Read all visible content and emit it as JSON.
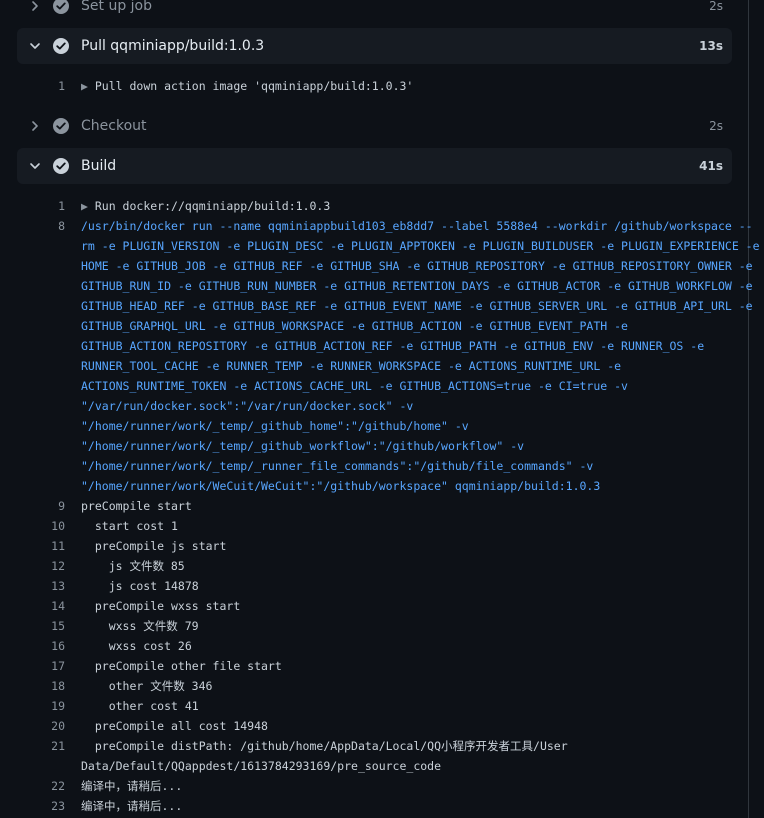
{
  "colors": {
    "background": "#0d1117",
    "panel": "#161b22",
    "success_check": "#8b949e",
    "command_text": "#58a6ff",
    "muted_text": "#8b949e"
  },
  "steps": [
    {
      "name": "Set up job",
      "duration": "2s",
      "state": "collapsed",
      "icon": "check-circle-icon"
    },
    {
      "name": "Pull qqminiapp/build:1.0.3",
      "duration": "13s",
      "state": "expanded",
      "icon": "check-circle-icon"
    },
    {
      "name": "Checkout",
      "duration": "2s",
      "state": "collapsed",
      "icon": "check-circle-icon"
    },
    {
      "name": "Build",
      "duration": "41s",
      "state": "expanded",
      "icon": "check-circle-icon"
    }
  ],
  "pull_log": [
    {
      "num": "1",
      "text": "Pull down action image 'qqminiapp/build:1.0.3'",
      "group": true
    }
  ],
  "build_log": [
    {
      "num": "1",
      "text": "Run docker://qqminiapp/build:1.0.3",
      "group": true
    },
    {
      "num": "8",
      "text": "/usr/bin/docker run --name qqminiappbuild103_eb8dd7 --label 5588e4 --workdir /github/workspace --",
      "cmd": true
    },
    {
      "num": "",
      "text": "rm -e PLUGIN_VERSION -e PLUGIN_DESC -e PLUGIN_APPTOKEN -e PLUGIN_BUILDUSER -e PLUGIN_EXPERIENCE -e",
      "cmd": true
    },
    {
      "num": "",
      "text": "HOME -e GITHUB_JOB -e GITHUB_REF -e GITHUB_SHA -e GITHUB_REPOSITORY -e GITHUB_REPOSITORY_OWNER -e",
      "cmd": true
    },
    {
      "num": "",
      "text": "GITHUB_RUN_ID -e GITHUB_RUN_NUMBER -e GITHUB_RETENTION_DAYS -e GITHUB_ACTOR -e GITHUB_WORKFLOW -e",
      "cmd": true
    },
    {
      "num": "",
      "text": "GITHUB_HEAD_REF -e GITHUB_BASE_REF -e GITHUB_EVENT_NAME -e GITHUB_SERVER_URL -e GITHUB_API_URL -e",
      "cmd": true
    },
    {
      "num": "",
      "text": "GITHUB_GRAPHQL_URL -e GITHUB_WORKSPACE -e GITHUB_ACTION -e GITHUB_EVENT_PATH -e",
      "cmd": true
    },
    {
      "num": "",
      "text": "GITHUB_ACTION_REPOSITORY -e GITHUB_ACTION_REF -e GITHUB_PATH -e GITHUB_ENV -e RUNNER_OS -e",
      "cmd": true
    },
    {
      "num": "",
      "text": "RUNNER_TOOL_CACHE -e RUNNER_TEMP -e RUNNER_WORKSPACE -e ACTIONS_RUNTIME_URL -e",
      "cmd": true
    },
    {
      "num": "",
      "text": "ACTIONS_RUNTIME_TOKEN -e ACTIONS_CACHE_URL -e GITHUB_ACTIONS=true -e CI=true -v",
      "cmd": true
    },
    {
      "num": "",
      "text": "\"/var/run/docker.sock\":\"/var/run/docker.sock\" -v",
      "cmd": true
    },
    {
      "num": "",
      "text": "\"/home/runner/work/_temp/_github_home\":\"/github/home\" -v",
      "cmd": true
    },
    {
      "num": "",
      "text": "\"/home/runner/work/_temp/_github_workflow\":\"/github/workflow\" -v",
      "cmd": true
    },
    {
      "num": "",
      "text": "\"/home/runner/work/_temp/_runner_file_commands\":\"/github/file_commands\" -v",
      "cmd": true
    },
    {
      "num": "",
      "text": "\"/home/runner/work/WeCuit/WeCuit\":\"/github/workspace\" qqminiapp/build:1.0.3",
      "cmd": true
    },
    {
      "num": "9",
      "text": "preCompile start"
    },
    {
      "num": "10",
      "text": "  start cost 1"
    },
    {
      "num": "11",
      "text": "  preCompile js start"
    },
    {
      "num": "12",
      "text": "    js 文件数 85"
    },
    {
      "num": "13",
      "text": "    js cost 14878"
    },
    {
      "num": "14",
      "text": "  preCompile wxss start"
    },
    {
      "num": "15",
      "text": "    wxss 文件数 79"
    },
    {
      "num": "16",
      "text": "    wxss cost 26"
    },
    {
      "num": "17",
      "text": "  preCompile other file start"
    },
    {
      "num": "18",
      "text": "    other 文件数 346"
    },
    {
      "num": "19",
      "text": "    other cost 41"
    },
    {
      "num": "20",
      "text": "  preCompile all cost 14948"
    },
    {
      "num": "21",
      "text": "  preCompile distPath: /github/home/AppData/Local/QQ小程序开发者工具/User"
    },
    {
      "num": "",
      "text": "Data/Default/QQappdest/1613784293169/pre_source_code"
    },
    {
      "num": "22",
      "text": "编译中，请稍后..."
    },
    {
      "num": "23",
      "text": "编译中，请稍后..."
    }
  ]
}
